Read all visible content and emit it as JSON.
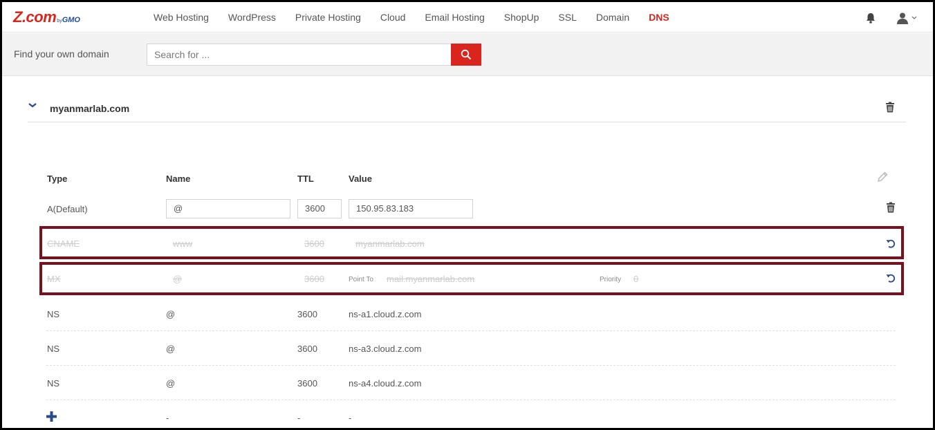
{
  "brand": {
    "main": "Z.com",
    "by": "by",
    "gmo": "GMO"
  },
  "nav": {
    "items": [
      {
        "label": "Web Hosting",
        "active": false
      },
      {
        "label": "WordPress",
        "active": false
      },
      {
        "label": "Private Hosting",
        "active": false
      },
      {
        "label": "Cloud",
        "active": false
      },
      {
        "label": "Email Hosting",
        "active": false
      },
      {
        "label": "ShopUp",
        "active": false
      },
      {
        "label": "SSL",
        "active": false
      },
      {
        "label": "Domain",
        "active": false
      },
      {
        "label": "DNS",
        "active": true
      }
    ],
    "icons": [
      "bell-icon",
      "user-icon",
      "chevron-down-icon"
    ]
  },
  "search": {
    "label": "Find your own domain",
    "placeholder": "Search for ...",
    "button_icon": "search-icon"
  },
  "domain": {
    "name": "myanmarlab.com"
  },
  "table": {
    "headers": {
      "type": "Type",
      "name": "Name",
      "ttl": "TTL",
      "value": "Value"
    },
    "editable_row": {
      "type": "A(Default)",
      "name": "@",
      "ttl": "3600",
      "value": "150.95.83.183"
    },
    "deleted_rows": [
      {
        "type": "CNAME",
        "name": "www",
        "ttl": "3600",
        "value": "myanmarlab.com"
      },
      {
        "type": "MX",
        "name": "@",
        "ttl": "3600",
        "point_to_label": "Point To",
        "value": "mail.myanmarlab.com",
        "priority_label": "Priority",
        "priority": "0"
      }
    ],
    "rows": [
      {
        "type": "NS",
        "name": "@",
        "ttl": "3600",
        "value": "ns-a1.cloud.z.com"
      },
      {
        "type": "NS",
        "name": "@",
        "ttl": "3600",
        "value": "ns-a3.cloud.z.com"
      },
      {
        "type": "NS",
        "name": "@",
        "ttl": "3600",
        "value": "ns-a4.cloud.z.com"
      }
    ],
    "add_row": {
      "name": "-",
      "ttl": "-",
      "value": "-"
    }
  },
  "colors": {
    "brand_red": "#d9251d",
    "brand_blue": "#1f4e9c",
    "highlight": "#7c0f1c",
    "icon_blue": "#2b4a8c"
  }
}
